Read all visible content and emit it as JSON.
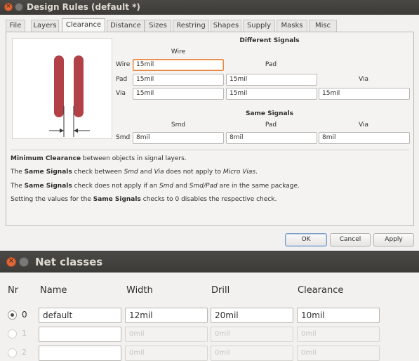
{
  "design_rules": {
    "title": "Design Rules (default *)",
    "tabs": [
      {
        "label": "File"
      },
      {
        "label": "Layers"
      },
      {
        "label": "Clearance"
      },
      {
        "label": "Distance"
      },
      {
        "label": "Sizes"
      },
      {
        "label": "Restring"
      },
      {
        "label": "Shapes"
      },
      {
        "label": "Supply"
      },
      {
        "label": "Masks"
      },
      {
        "label": "Misc"
      }
    ],
    "active_tab": "Clearance",
    "different_signals": {
      "heading": "Different Signals",
      "columns": {
        "wire": "Wire",
        "pad": "Pad",
        "via": "Via"
      },
      "rows": {
        "wire": "Wire",
        "pad": "Pad",
        "via": "Via"
      },
      "wire_wire": "15mil",
      "pad_wire": "15mil",
      "pad_pad": "15mil",
      "via_wire": "15mil",
      "via_pad": "15mil",
      "via_via": "15mil"
    },
    "same_signals": {
      "heading": "Same Signals",
      "columns": {
        "smd": "Smd",
        "pad": "Pad",
        "via": "Via"
      },
      "row": "Smd",
      "smd_smd": "8mil",
      "smd_pad": "8mil",
      "smd_via": "8mil"
    },
    "info": {
      "line1_bold": "Minimum Clearance",
      "line1_rest": " between objects in signal layers.",
      "line2_a": "The ",
      "line2_bold": "Same Signals",
      "line2_b": " check between ",
      "line2_i1": "Smd",
      "line2_c": " and ",
      "line2_i2": "Via",
      "line2_d": " does not apply to ",
      "line2_i3": "Micro Vias",
      "line2_e": ".",
      "line3_a": "The ",
      "line3_bold": "Same Signals",
      "line3_b": " check does not apply if an ",
      "line3_i1": "Smd",
      "line3_c": " and ",
      "line3_i2": "Smd/Pad",
      "line3_d": " are in the same package.",
      "line4_a": "Setting the values for the ",
      "line4_bold": "Same Signals",
      "line4_b": " checks to 0 disables the respective check."
    },
    "buttons": {
      "ok": "OK",
      "cancel": "Cancel",
      "apply": "Apply"
    }
  },
  "net_classes": {
    "title": "Net classes",
    "headers": {
      "nr": "Nr",
      "name": "Name",
      "width": "Width",
      "drill": "Drill",
      "clearance": "Clearance"
    },
    "rows": [
      {
        "nr": "0",
        "name": "default",
        "width": "12mil",
        "drill": "20mil",
        "clearance": "10mil"
      },
      {
        "nr": "1",
        "name": "",
        "width": "0mil",
        "drill": "0mil",
        "clearance": "0mil"
      },
      {
        "nr": "2",
        "name": "",
        "width": "0mil",
        "drill": "0mil",
        "clearance": "0mil"
      }
    ]
  },
  "colors": {
    "trace": "#b14147",
    "titlebar": "#3c3b37",
    "close_button": "#e0683a",
    "focus": "#e9853b"
  }
}
